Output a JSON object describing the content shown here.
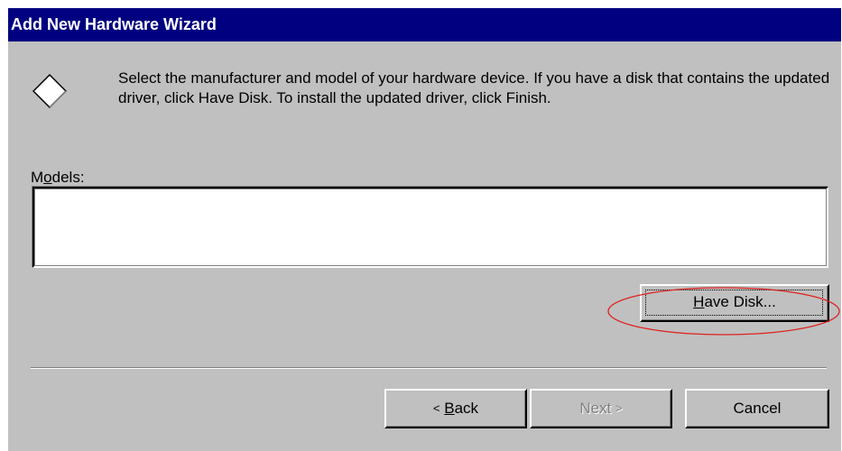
{
  "window": {
    "title": "Add New Hardware Wizard"
  },
  "icon": "diamond-icon",
  "instructions": "Select the manufacturer and model of your hardware device. If you have a disk that contains the updated driver, click Have Disk. To install the updated driver, click Finish.",
  "models": {
    "label_accel": "o",
    "label_before": "M",
    "label_after": "dels:",
    "items": []
  },
  "have_disk": {
    "accel": "H",
    "rest": "ave Disk..."
  },
  "buttons": {
    "back_prefix": "<",
    "back_accel": "B",
    "back_rest": "ack",
    "next_label": "Next",
    "next_suffix": ">",
    "cancel_label": "Cancel"
  },
  "annotation": {
    "color": "#e02020"
  }
}
